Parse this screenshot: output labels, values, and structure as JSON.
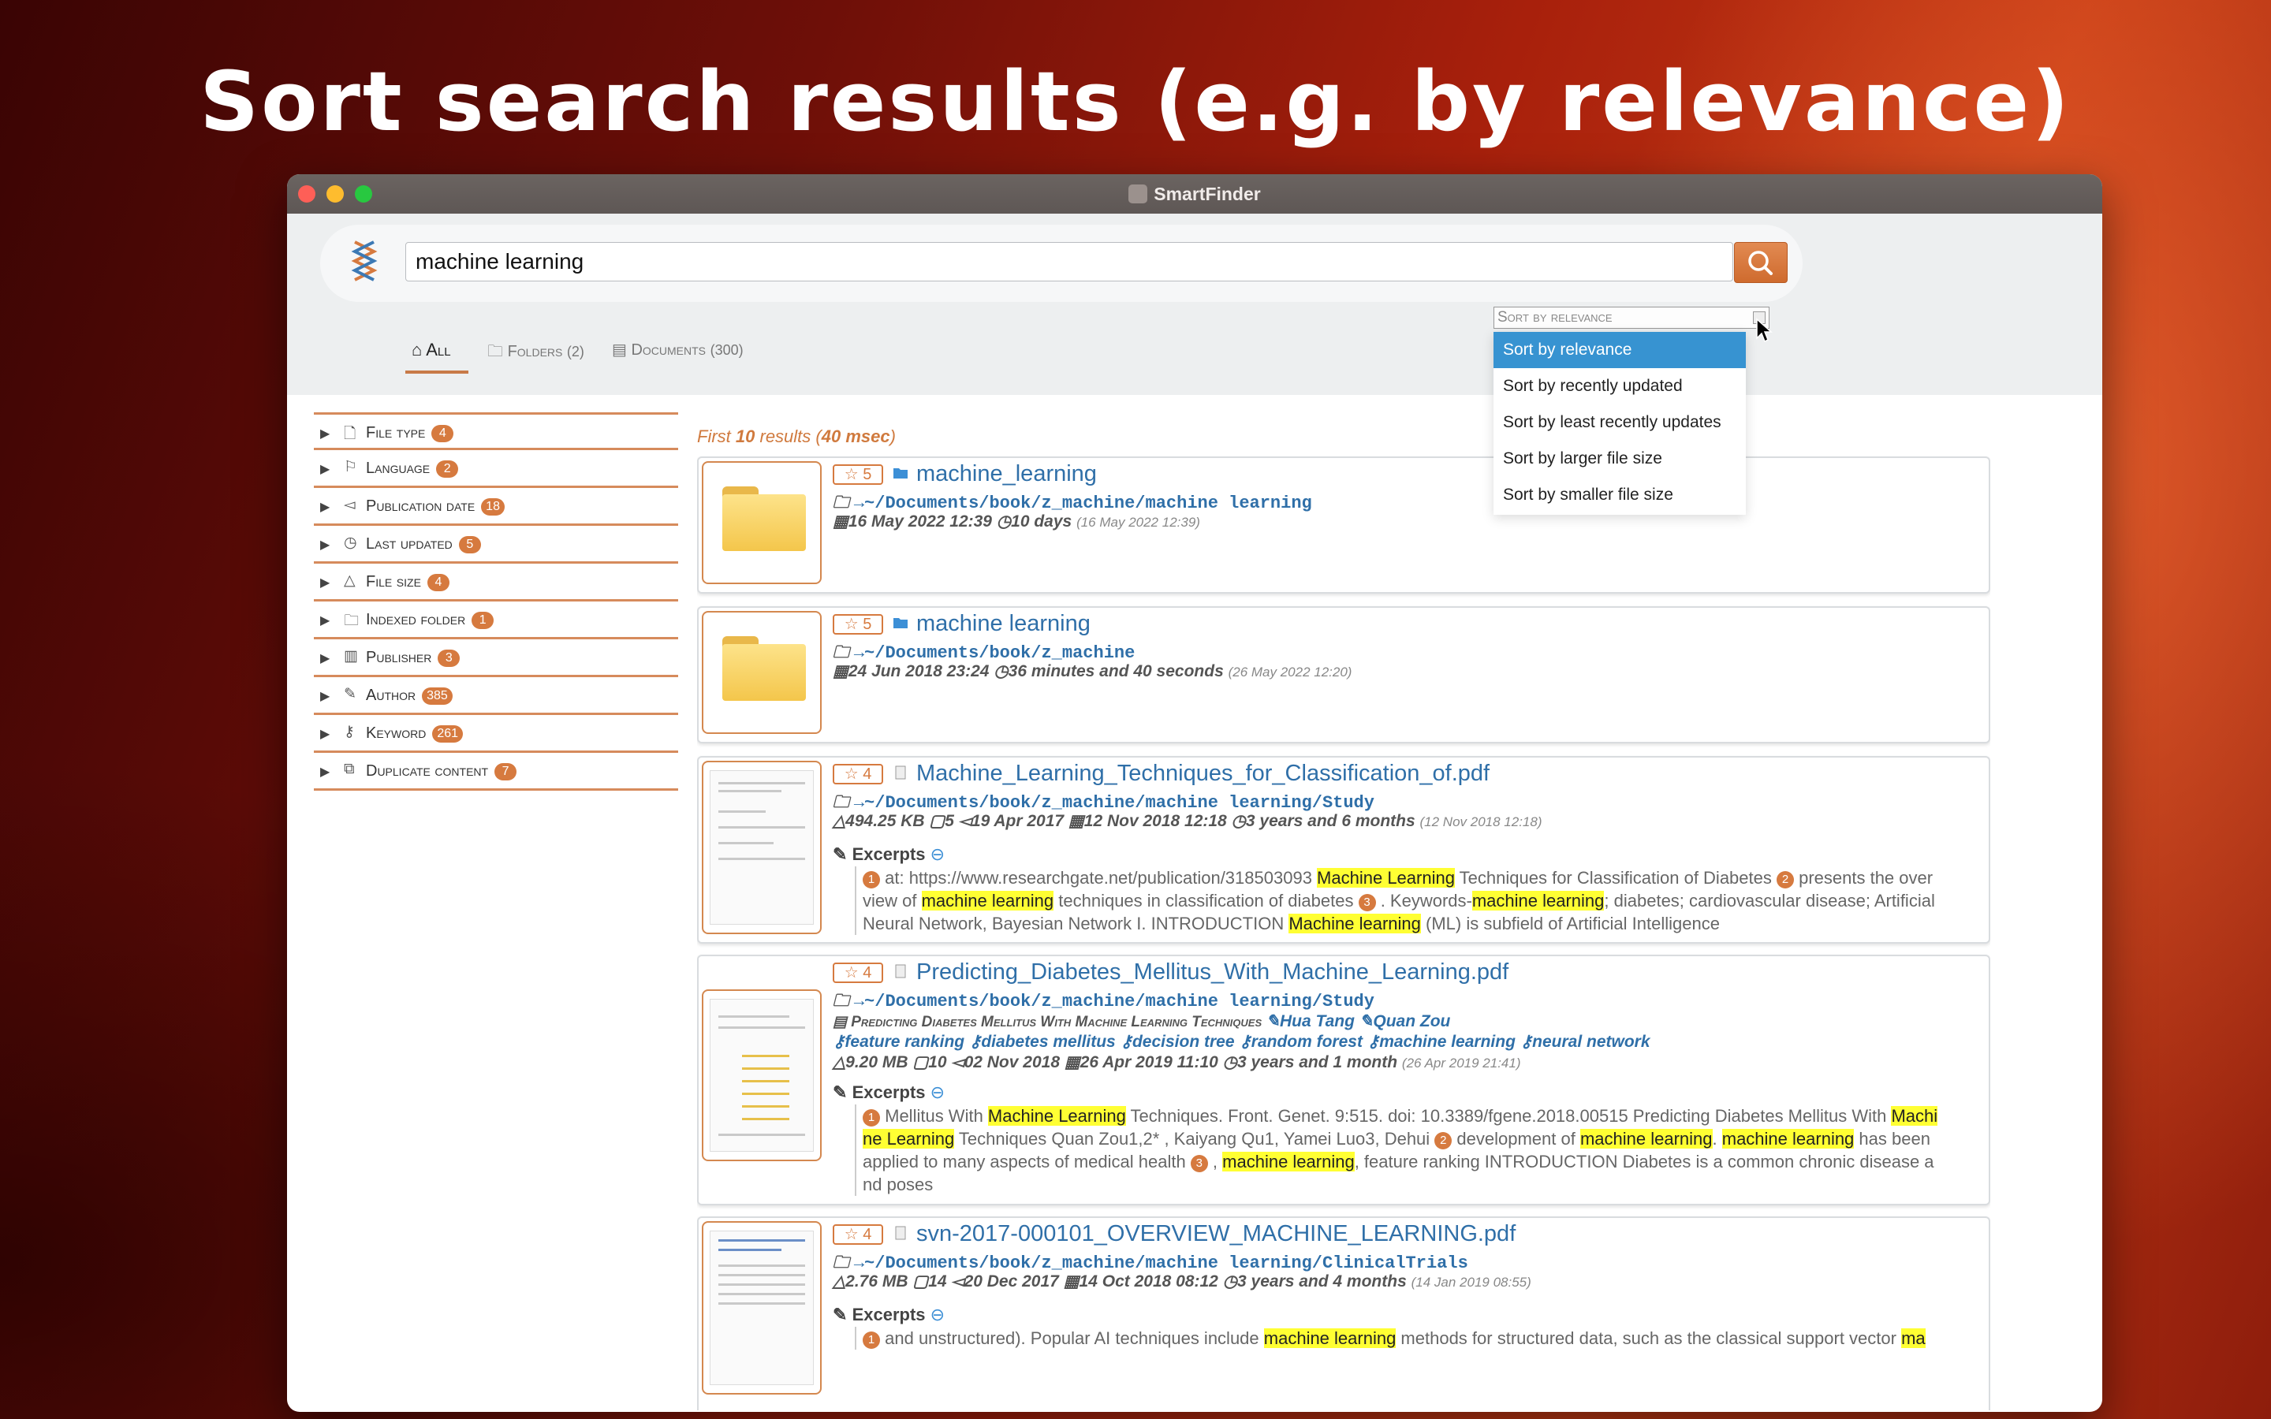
{
  "hero": {
    "title": "Sort search results (e.g. by relevance)"
  },
  "window": {
    "title": "SmartFinder"
  },
  "search": {
    "value": "machine learning",
    "button": "search"
  },
  "tabs": [
    {
      "label": "All",
      "count": ""
    },
    {
      "label": "Folders",
      "count": "(2)"
    },
    {
      "label": "Documents",
      "count": "(300)"
    }
  ],
  "sort": {
    "selected": "Sort by relevance",
    "options": [
      "Sort by relevance",
      "Sort by recently updated",
      "Sort by least recently updates",
      "Sort by larger file size",
      "Sort by smaller file size"
    ]
  },
  "facets": [
    {
      "label": "File type",
      "count": "4",
      "icon": "file-icon"
    },
    {
      "label": "Language",
      "count": "2",
      "icon": "flag-icon"
    },
    {
      "label": "Publication date",
      "count": "18",
      "icon": "megaphone-icon"
    },
    {
      "label": "Last updated",
      "count": "5",
      "icon": "clock-icon"
    },
    {
      "label": "File size",
      "count": "4",
      "icon": "weight-icon"
    },
    {
      "label": "Indexed folder",
      "count": "1",
      "icon": "folder-icon"
    },
    {
      "label": "Publisher",
      "count": "3",
      "icon": "book-icon"
    },
    {
      "label": "Author",
      "count": "385",
      "icon": "pen-icon"
    },
    {
      "label": "Keyword",
      "count": "261",
      "icon": "key-icon"
    },
    {
      "label": "Duplicate content",
      "count": "7",
      "icon": "duplicate-icon"
    }
  ],
  "results_head": {
    "prefix": "First",
    "count": "10",
    "middle": "results (",
    "time": "40 msec",
    "suffix": ")"
  },
  "results": {
    "r1": {
      "rank": "5",
      "title": "machine_learning",
      "path": "→~/Documents/book/z_machine/machine learning",
      "date": "16 May 2022 12:39",
      "ago": "10 days",
      "ago_date": "(16 May 2022 12:39)"
    },
    "r2": {
      "rank": "5",
      "title": "machine learning",
      "path": "→~/Documents/book/z_machine",
      "date": "24 Jun 2018 23:24",
      "ago": "36 minutes and 40 seconds",
      "ago_date": "(26 May 2022 12:20)"
    },
    "r3": {
      "rank": "4",
      "title": "Machine_Learning_Techniques_for_Classification_of.pdf",
      "path": "→~/Documents/book/z_machine/machine learning/Study",
      "size": "494.25 KB",
      "pages": "5",
      "published": "19 Apr 2017",
      "updated": "12 Nov 2018 12:18",
      "ago": "3 years and 6 months",
      "ago_date": "(12 Nov 2018 12:18)",
      "excerpts_label": "Excerpts",
      "ex": [
        "at: https://www.researchgate.net/publication/318503093 ",
        "Machine Learning",
        " Techniques for Classification of Diabetes ",
        " presents the overview of ",
        "machine learning",
        " techniques in classification of diabetes ",
        " . Keywords-",
        "machine learning",
        "; diabetes; cardiovascular disease; Artificial Neural Network, Bayesian Network I. INTRODUCTION ",
        "Machine learning",
        " (ML) is subfield of Artificial Intelligence"
      ]
    },
    "r4": {
      "rank": "4",
      "title": "Predicting_Diabetes_Mellitus_With_Machine_Learning.pdf",
      "path": "→~/Documents/book/z_machine/machine learning/Study",
      "doc_title": "Predicting Diabetes Mellitus With Machine Learning Techniques",
      "author1": "Hua Tang",
      "author2": "Quan Zou",
      "keywords": [
        "feature ranking",
        "diabetes mellitus",
        "decision tree",
        "random forest",
        "machine learning",
        "neural network"
      ],
      "size": "9.20 MB",
      "pages": "10",
      "published": "02 Nov 2018",
      "updated": "26 Apr 2019 11:10",
      "ago": "3 years and 1 month",
      "ago_date": "(26 Apr 2019 21:41)",
      "excerpts_label": "Excerpts",
      "ex": [
        "Mellitus With ",
        "Machine Learning",
        " Techniques. Front. Genet. 9:515. doi: 10.3389/fgene.2018.00515 Predicting Diabetes Mellitus With ",
        "Machine Learning",
        " Techniques Quan Zou1,2* , Kaiyang Qu1, Yamei Luo3, Dehui ",
        " development of ",
        "machine learning",
        ". ",
        "machine learning",
        " has been applied to many aspects of medical health ",
        " , ",
        "machine learning",
        ", feature ranking INTRODUCTION Diabetes is a common chronic disease and poses"
      ]
    },
    "r5": {
      "rank": "4",
      "title": "svn-2017-000101_OVERVIEW_MACHINE_LEARNING.pdf",
      "path": "→~/Documents/book/z_machine/machine learning/ClinicalTrials",
      "size": "2.76 MB",
      "pages": "14",
      "published": "20 Dec 2017",
      "updated": "14 Oct 2018 08:12",
      "ago": "3 years and 4 months",
      "ago_date": "(14 Jan 2019 08:55)",
      "excerpts_label": "Excerpts",
      "ex": [
        "and unstructured). Popular AI techniques include ",
        "machine learning",
        " methods for structured data, such as the classical support vector ",
        "ma"
      ]
    }
  }
}
